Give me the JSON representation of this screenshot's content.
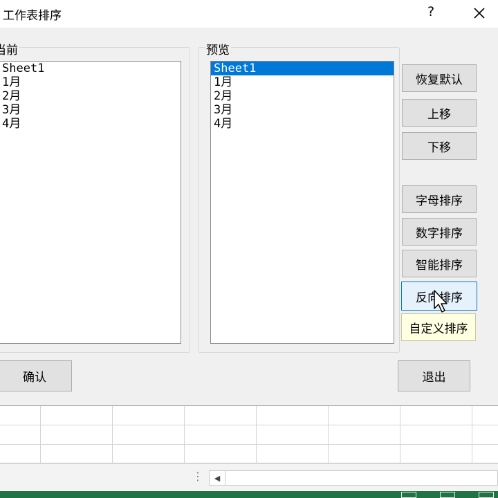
{
  "dialog": {
    "title": "工作表排序",
    "help_label": "?",
    "current_group_label": "当前",
    "preview_group_label": "预览",
    "current_list": [
      "Sheet1",
      "1月",
      "2月",
      "3月",
      "4月"
    ],
    "preview_list": [
      "Sheet1",
      "1月",
      "2月",
      "3月",
      "4月"
    ],
    "preview_selected": "Sheet1",
    "buttons": {
      "restore_default": "恢复默认",
      "move_up": "上移",
      "move_down": "下移",
      "alpha_sort": "字母排序",
      "number_sort": "数字排序",
      "smart_sort": "智能排序",
      "reverse_sort": "反向排序",
      "custom_sort": "自定义排序",
      "confirm": "确认",
      "exit": "退出"
    }
  },
  "colors": {
    "selection": "#0078d7",
    "status_bar": "#217346",
    "tooltip_bg": "#ffffe1"
  },
  "icons": [
    "close-icon",
    "mouse-cursor-icon",
    "scroll-left-arrow-icon",
    "vertical-dots-icon",
    "normal-view-icon",
    "page-layout-view-icon"
  ]
}
